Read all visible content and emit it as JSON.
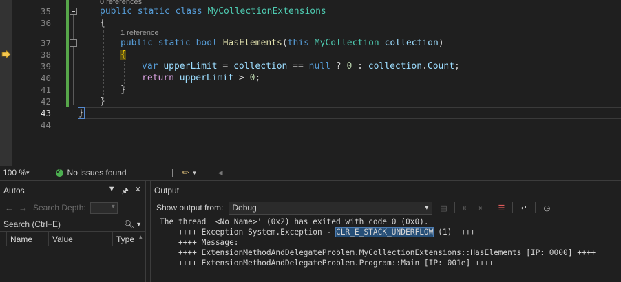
{
  "editor": {
    "line_numbers": [
      "35",
      "36",
      "37",
      "38",
      "39",
      "40",
      "41",
      "42",
      "43",
      "44"
    ],
    "current_line": "43",
    "codelens_0": "0 references",
    "codelens_1": "1 reference",
    "l35": {
      "kw1": "public",
      "kw2": "static",
      "kw3": "class",
      "name": "MyCollectionExtensions"
    },
    "l36": {
      "brace": "{"
    },
    "l37": {
      "kw1": "public",
      "kw2": "static",
      "kw3": "bool",
      "fn": "HasElements",
      "open": "(",
      "kw4": "this",
      "type": "MyCollection",
      "param": "collection",
      "close": ")"
    },
    "l38": {
      "brace": "{"
    },
    "l39": {
      "kw": "var",
      "v1": "upperLimit",
      "eq": " = ",
      "p1": "collection",
      "op": " == ",
      "nul": "null",
      "q": " ? ",
      "z": "0",
      "c": " : ",
      "p2": "collection",
      "dot": ".",
      "prop": "Count",
      "semi": ";"
    },
    "l40": {
      "kw": "return",
      "v1": "upperLimit",
      "op": " > ",
      "z": "0",
      "semi": ";"
    },
    "l41": {
      "brace": "}"
    },
    "l42": {
      "brace": "}"
    },
    "l43": {
      "brace": "}"
    }
  },
  "status": {
    "zoom": "100 %",
    "issues": "No issues found"
  },
  "autos": {
    "title": "Autos",
    "search_depth_label": "Search Depth:",
    "search_placeholder": "Search (Ctrl+E)",
    "columns": [
      "Name",
      "Value",
      "Type"
    ]
  },
  "output": {
    "title": "Output",
    "show_from_label": "Show output from:",
    "source": "Debug",
    "lines": {
      "l1": "The thread '<No Name>' (0x2) has exited with code 0 (0x0).",
      "l2_pre": "    ++++ Exception System.Exception - ",
      "l2_sel": "CLR_E_STACK_UNDERFLOW",
      "l2_post": " (1) ++++",
      "l3": "    ++++ Message:",
      "l4": "    ++++ ExtensionMethodAndDelegateProblem.MyCollectionExtensions::HasElements [IP: 0000] ++++",
      "l5": "    ++++ ExtensionMethodAndDelegateProblem.Program::Main [IP: 001e] ++++"
    }
  },
  "colors": {
    "background": "#1f1f1f",
    "keyword": "#569cd6",
    "type": "#4ec9b0",
    "method": "#dcdcaa",
    "parameter": "#9cdcfe",
    "number": "#b5cea8",
    "control_keyword": "#d8a0df",
    "change_bar": "#57a64a",
    "selection": "#264f78"
  },
  "icons": [
    "execution-pointer-icon",
    "fold-icon",
    "check-circle-icon",
    "broom-icon",
    "pin-icon",
    "close-icon",
    "search-icon",
    "clear-all-icon",
    "word-wrap-icon",
    "clock-icon"
  ]
}
